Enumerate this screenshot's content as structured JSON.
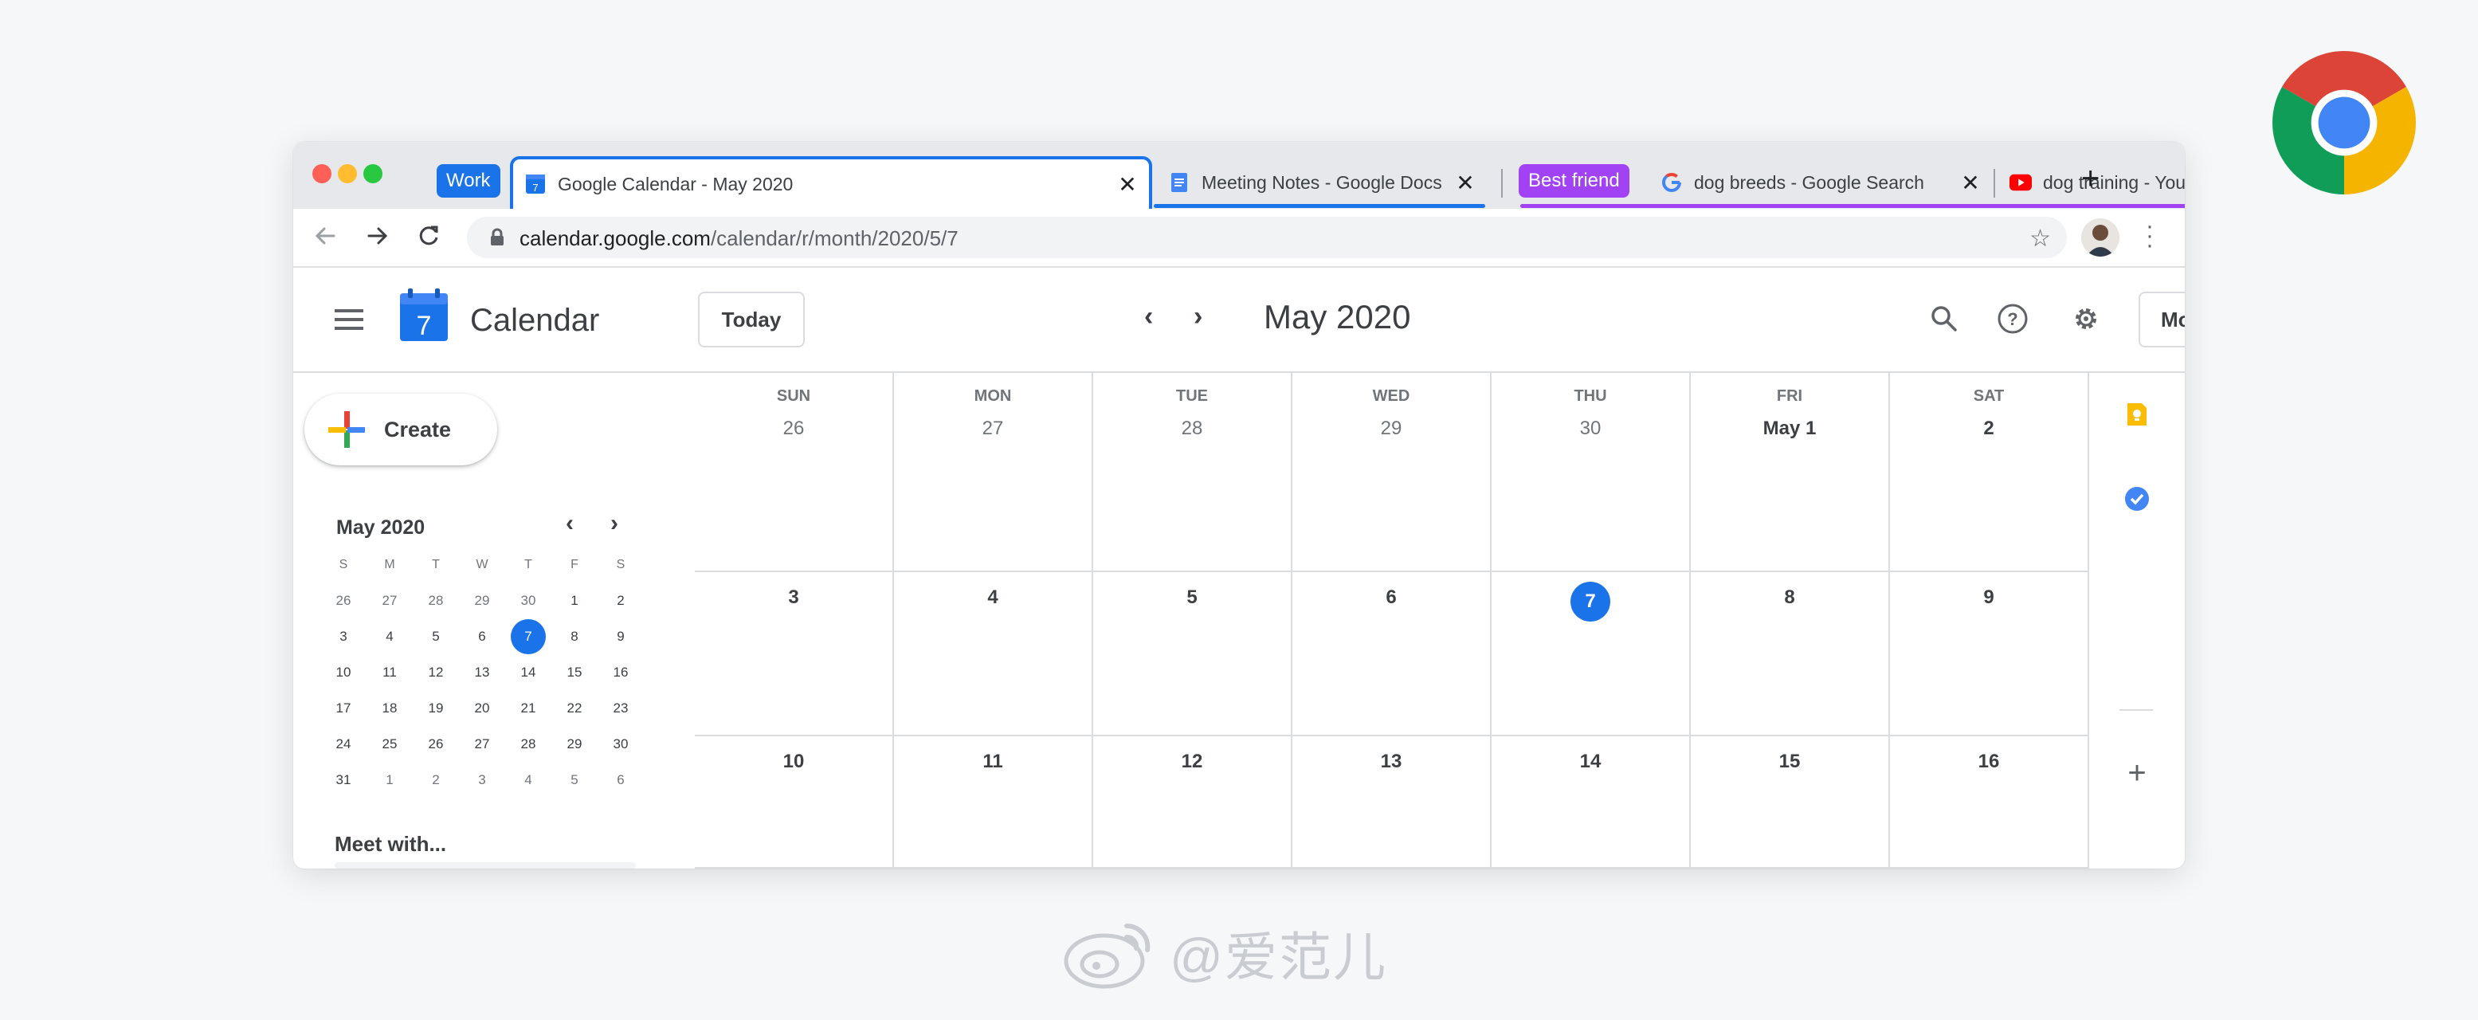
{
  "tabstrip": {
    "group_work": {
      "label": "Work",
      "color": "#1a73e8"
    },
    "group_best_friend": {
      "label": "Best friend",
      "color": "#a142f4"
    },
    "tabs": [
      {
        "title": "Google Calendar - May 2020",
        "icon": "google-calendar-icon",
        "active": true
      },
      {
        "title": "Meeting Notes - Google Docs",
        "icon": "google-docs-icon"
      },
      {
        "title": "dog breeds - Google Search",
        "icon": "google-g-icon"
      },
      {
        "title": "dog training - YouTube",
        "icon": "youtube-icon"
      }
    ],
    "new_tab": "+"
  },
  "toolbar": {
    "url_host": "calendar.google.com",
    "url_path": "/calendar/r/month/2020/5/7"
  },
  "header": {
    "app_name": "Calendar",
    "logo_day": "7",
    "today_label": "Today",
    "month_title": "May 2020",
    "view_label": "Month"
  },
  "sidebar": {
    "create_label": "Create",
    "mini_title": "May 2020",
    "weekday_heads": [
      "S",
      "M",
      "T",
      "W",
      "T",
      "F",
      "S"
    ],
    "mini_days": [
      "26",
      "27",
      "28",
      "29",
      "30",
      "1",
      "2",
      "3",
      "4",
      "5",
      "6",
      "7",
      "8",
      "9",
      "10",
      "11",
      "12",
      "13",
      "14",
      "15",
      "16",
      "17",
      "18",
      "19",
      "20",
      "21",
      "22",
      "23",
      "24",
      "25",
      "26",
      "27",
      "28",
      "29",
      "30",
      "31",
      "1",
      "2",
      "3",
      "4",
      "5",
      "6"
    ],
    "selected_day": "7",
    "meet_with": "Meet with..."
  },
  "month": {
    "weekdays": [
      "SUN",
      "MON",
      "TUE",
      "WED",
      "THU",
      "FRI",
      "SAT"
    ],
    "rows": [
      [
        "26",
        "27",
        "28",
        "29",
        "30",
        "May 1",
        "2"
      ],
      [
        "3",
        "4",
        "5",
        "6",
        "7",
        "8",
        "9"
      ],
      [
        "10",
        "11",
        "12",
        "13",
        "14",
        "15",
        "16"
      ]
    ],
    "today": "7"
  },
  "watermark": {
    "text": "@爱范儿"
  },
  "colors": {
    "accent": "#1a73e8",
    "best_friend": "#a142f4"
  }
}
